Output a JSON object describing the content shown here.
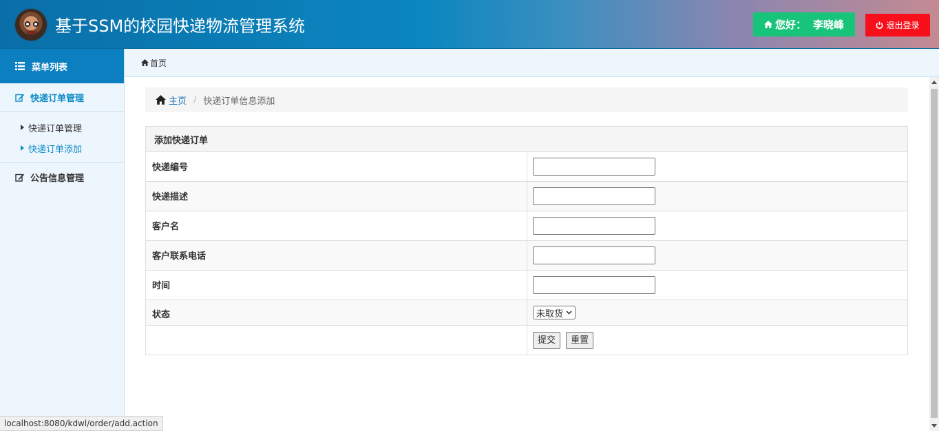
{
  "header": {
    "title": "基于SSM的校园快递物流管理系统",
    "greeting": "您好：",
    "user": "李晓峰",
    "logout_label": "退出登录",
    "colors": {
      "greet_bg": "#18c37a",
      "logout_bg": "#f70f1b"
    }
  },
  "sidebar": {
    "menu_title": "菜单列表",
    "groups": [
      {
        "label": "快递订单管理",
        "items": [
          {
            "label": "快递订单管理"
          },
          {
            "label": "快递订单添加"
          }
        ]
      },
      {
        "label": "公告信息管理"
      }
    ]
  },
  "tabbar": {
    "home_label": "首页"
  },
  "breadcrumb": {
    "home": "主页",
    "current": "快递订单信息添加"
  },
  "form": {
    "caption": "添加快递订单",
    "fields": [
      {
        "label": "快递编号",
        "value": ""
      },
      {
        "label": "快递描述",
        "value": ""
      },
      {
        "label": "客户名",
        "value": ""
      },
      {
        "label": "客户联系电话",
        "value": ""
      },
      {
        "label": "时间",
        "value": ""
      }
    ],
    "status_label": "状态",
    "status_value": "未取货",
    "submit_label": "提交",
    "reset_label": "重置"
  },
  "statusbar": {
    "url": "localhost:8080/kdwl/order/add.action"
  }
}
